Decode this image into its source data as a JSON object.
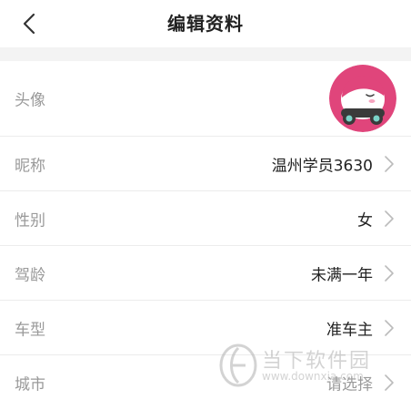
{
  "header": {
    "title": "编辑资料",
    "back_icon": "chevron-left-icon"
  },
  "profile": {
    "avatar": {
      "label": "头像",
      "icon": "avatar-car-mascot",
      "colors": {
        "ring": "#e0457b",
        "face": "#ffffff",
        "hair": "#e0457b",
        "wheels": "#3a3a3a",
        "wheel_hub": "#7ad3c8"
      }
    },
    "nickname": {
      "label": "昵称",
      "value": "温州学员3630"
    },
    "gender": {
      "label": "性别",
      "value": "女"
    },
    "driving_age": {
      "label": "驾龄",
      "value": "未满一年"
    },
    "car_type": {
      "label": "车型",
      "value": "准车主"
    },
    "city": {
      "label": "城市",
      "value": "请选择"
    }
  },
  "watermark": {
    "name": "当下软件园",
    "url": "www.downxia.com"
  },
  "colors": {
    "label": "#9a9a9a",
    "value": "#222222",
    "divider": "#ececec",
    "section_gap": "#f3f3f3",
    "chevron": "#bbbbbb"
  }
}
